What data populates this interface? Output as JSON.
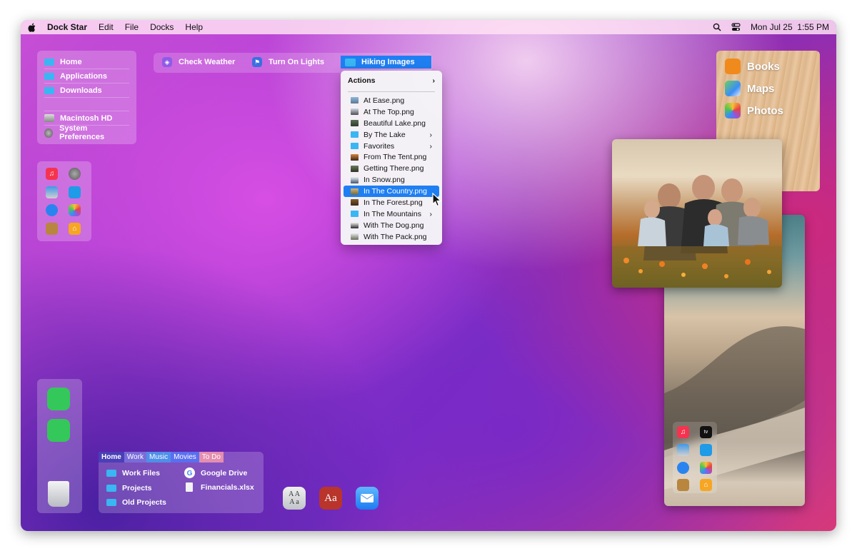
{
  "menubar": {
    "app_name": "Dock Star",
    "items": [
      "Edit",
      "File",
      "Docks",
      "Help"
    ],
    "datetime": "Mon Jul 25  1:55 PM"
  },
  "shortcuts": [
    "Home",
    "Applications",
    "Downloads",
    "Macintosh HD",
    "System Preferences"
  ],
  "actions": {
    "weather": "Check Weather",
    "lights": "Turn On Lights",
    "hiking": "Hiking Images"
  },
  "menu": {
    "header": "Actions",
    "items": [
      {
        "label": "At Ease.png",
        "submenu": false
      },
      {
        "label": "At The Top.png",
        "submenu": false
      },
      {
        "label": "Beautiful Lake.png",
        "submenu": false
      },
      {
        "label": "By The Lake",
        "submenu": true
      },
      {
        "label": "Favorites",
        "submenu": true
      },
      {
        "label": "From The Tent.png",
        "submenu": false
      },
      {
        "label": "Getting There.png",
        "submenu": false
      },
      {
        "label": "In Snow.png",
        "submenu": false
      },
      {
        "label": "In The Country.png",
        "submenu": false,
        "selected": true
      },
      {
        "label": "In The Forest.png",
        "submenu": false
      },
      {
        "label": "In The Mountains",
        "submenu": true
      },
      {
        "label": "With The Dog.png",
        "submenu": false
      },
      {
        "label": "With The Pack.png",
        "submenu": false
      }
    ]
  },
  "books_panel": [
    "Books",
    "Maps",
    "Photos"
  ],
  "tabs": [
    "Home",
    "Work",
    "Music",
    "Movies",
    "To Do"
  ],
  "tab_files": {
    "work_files": "Work Files",
    "google_drive": "Google Drive",
    "projects": "Projects",
    "financials": "Financials.xlsx",
    "old_projects": "Old Projects"
  },
  "icons": {
    "font_book": "A A\nA a",
    "dictionary": "Aa",
    "apple_tv": "tv"
  },
  "colors": {
    "selection": "#1f7ff2",
    "folder": "#3ab6f3"
  }
}
